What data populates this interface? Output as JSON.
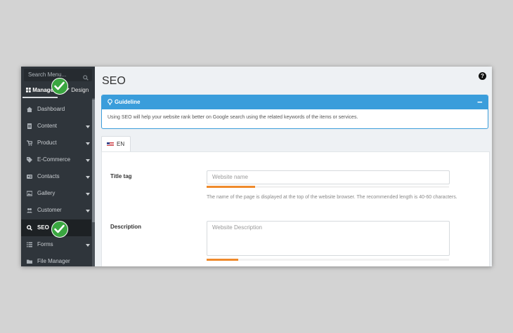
{
  "sidebar": {
    "search_placeholder": "Search Menu...",
    "tabs": {
      "manage": "Manage",
      "design": "Design"
    },
    "items": [
      {
        "label": "Dashboard",
        "icon": "dashboard-icon"
      },
      {
        "label": "Content",
        "icon": "document-icon"
      },
      {
        "label": "Product",
        "icon": "cart-icon"
      },
      {
        "label": "E-Commerce",
        "icon": "tag-icon"
      },
      {
        "label": "Contacts",
        "icon": "id-card-icon"
      },
      {
        "label": "Gallery",
        "icon": "image-icon"
      },
      {
        "label": "Customer",
        "icon": "users-icon"
      },
      {
        "label": "SEO",
        "icon": "search-icon"
      },
      {
        "label": "Forms",
        "icon": "list-icon"
      },
      {
        "label": "File Manager",
        "icon": "folder-icon"
      }
    ]
  },
  "page": {
    "title": "SEO"
  },
  "guideline": {
    "title": "Guideline",
    "text": "Using SEO will help your website rank better on Google search using the related keywords of the items or services."
  },
  "language_tab": {
    "label": "EN"
  },
  "form": {
    "title_tag": {
      "label": "Title tag",
      "placeholder": "Website name",
      "progress": 0.2,
      "help": "The name of the page is displayed at the top of the website browser. The recommended length is 40-60 characters."
    },
    "description": {
      "label": "Description",
      "placeholder": "Website Description",
      "progress": 0.13
    }
  },
  "colors": {
    "sidebar_bg": "#2f353b",
    "accent_blue": "#3a9ddb",
    "progress_orange": "#ef8a2c",
    "check_green": "#3aa640"
  }
}
